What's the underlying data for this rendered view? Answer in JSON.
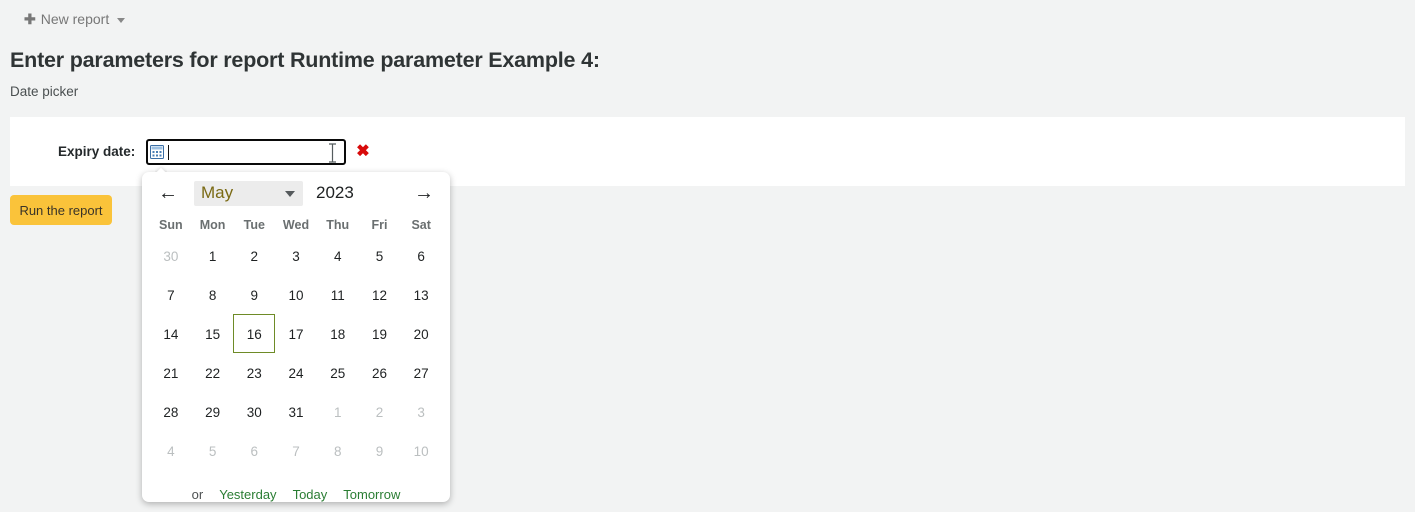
{
  "topnav": {
    "plus_glyph": "✚",
    "new_report_label": "New report"
  },
  "header": {
    "title": "Enter parameters for report Runtime parameter Example 4:",
    "subtitle": "Date picker"
  },
  "form": {
    "label": "Expiry date:",
    "input_value": "",
    "input_placeholder": "",
    "calendar_icon": "calendar-icon",
    "clear_glyph": "✖",
    "run_button_label": "Run the report"
  },
  "datepicker": {
    "prev_glyph": "←",
    "next_glyph": "→",
    "month": "May",
    "year": "2023",
    "weekdays": [
      "Sun",
      "Mon",
      "Tue",
      "Wed",
      "Thu",
      "Fri",
      "Sat"
    ],
    "weeks": [
      [
        {
          "d": "30",
          "other": true,
          "selected": false
        },
        {
          "d": "1",
          "other": false,
          "selected": false
        },
        {
          "d": "2",
          "other": false,
          "selected": false
        },
        {
          "d": "3",
          "other": false,
          "selected": false
        },
        {
          "d": "4",
          "other": false,
          "selected": false
        },
        {
          "d": "5",
          "other": false,
          "selected": false
        },
        {
          "d": "6",
          "other": false,
          "selected": false
        }
      ],
      [
        {
          "d": "7",
          "other": false,
          "selected": false
        },
        {
          "d": "8",
          "other": false,
          "selected": false
        },
        {
          "d": "9",
          "other": false,
          "selected": false
        },
        {
          "d": "10",
          "other": false,
          "selected": false
        },
        {
          "d": "11",
          "other": false,
          "selected": false
        },
        {
          "d": "12",
          "other": false,
          "selected": false
        },
        {
          "d": "13",
          "other": false,
          "selected": false
        }
      ],
      [
        {
          "d": "14",
          "other": false,
          "selected": false
        },
        {
          "d": "15",
          "other": false,
          "selected": false
        },
        {
          "d": "16",
          "other": false,
          "selected": true
        },
        {
          "d": "17",
          "other": false,
          "selected": false
        },
        {
          "d": "18",
          "other": false,
          "selected": false
        },
        {
          "d": "19",
          "other": false,
          "selected": false
        },
        {
          "d": "20",
          "other": false,
          "selected": false
        }
      ],
      [
        {
          "d": "21",
          "other": false,
          "selected": false
        },
        {
          "d": "22",
          "other": false,
          "selected": false
        },
        {
          "d": "23",
          "other": false,
          "selected": false
        },
        {
          "d": "24",
          "other": false,
          "selected": false
        },
        {
          "d": "25",
          "other": false,
          "selected": false
        },
        {
          "d": "26",
          "other": false,
          "selected": false
        },
        {
          "d": "27",
          "other": false,
          "selected": false
        }
      ],
      [
        {
          "d": "28",
          "other": false,
          "selected": false
        },
        {
          "d": "29",
          "other": false,
          "selected": false
        },
        {
          "d": "30",
          "other": false,
          "selected": false
        },
        {
          "d": "31",
          "other": false,
          "selected": false
        },
        {
          "d": "1",
          "other": true,
          "selected": false
        },
        {
          "d": "2",
          "other": true,
          "selected": false
        },
        {
          "d": "3",
          "other": true,
          "selected": false
        }
      ],
      [
        {
          "d": "4",
          "other": true,
          "selected": false
        },
        {
          "d": "5",
          "other": true,
          "selected": false
        },
        {
          "d": "6",
          "other": true,
          "selected": false
        },
        {
          "d": "7",
          "other": true,
          "selected": false
        },
        {
          "d": "8",
          "other": true,
          "selected": false
        },
        {
          "d": "9",
          "other": true,
          "selected": false
        },
        {
          "d": "10",
          "other": true,
          "selected": false
        }
      ]
    ],
    "footer": {
      "or_label": "or",
      "yesterday_label": "Yesterday",
      "today_label": "Today",
      "tomorrow_label": "Tomorrow"
    }
  },
  "colors": {
    "page_background": "#f2f3f3",
    "accent_button": "#fac33a",
    "quick_link": "#2a7d33",
    "selected_day_border": "#6e8b27",
    "clear_icon": "#d80b0b",
    "month_text": "#7a6a14"
  }
}
